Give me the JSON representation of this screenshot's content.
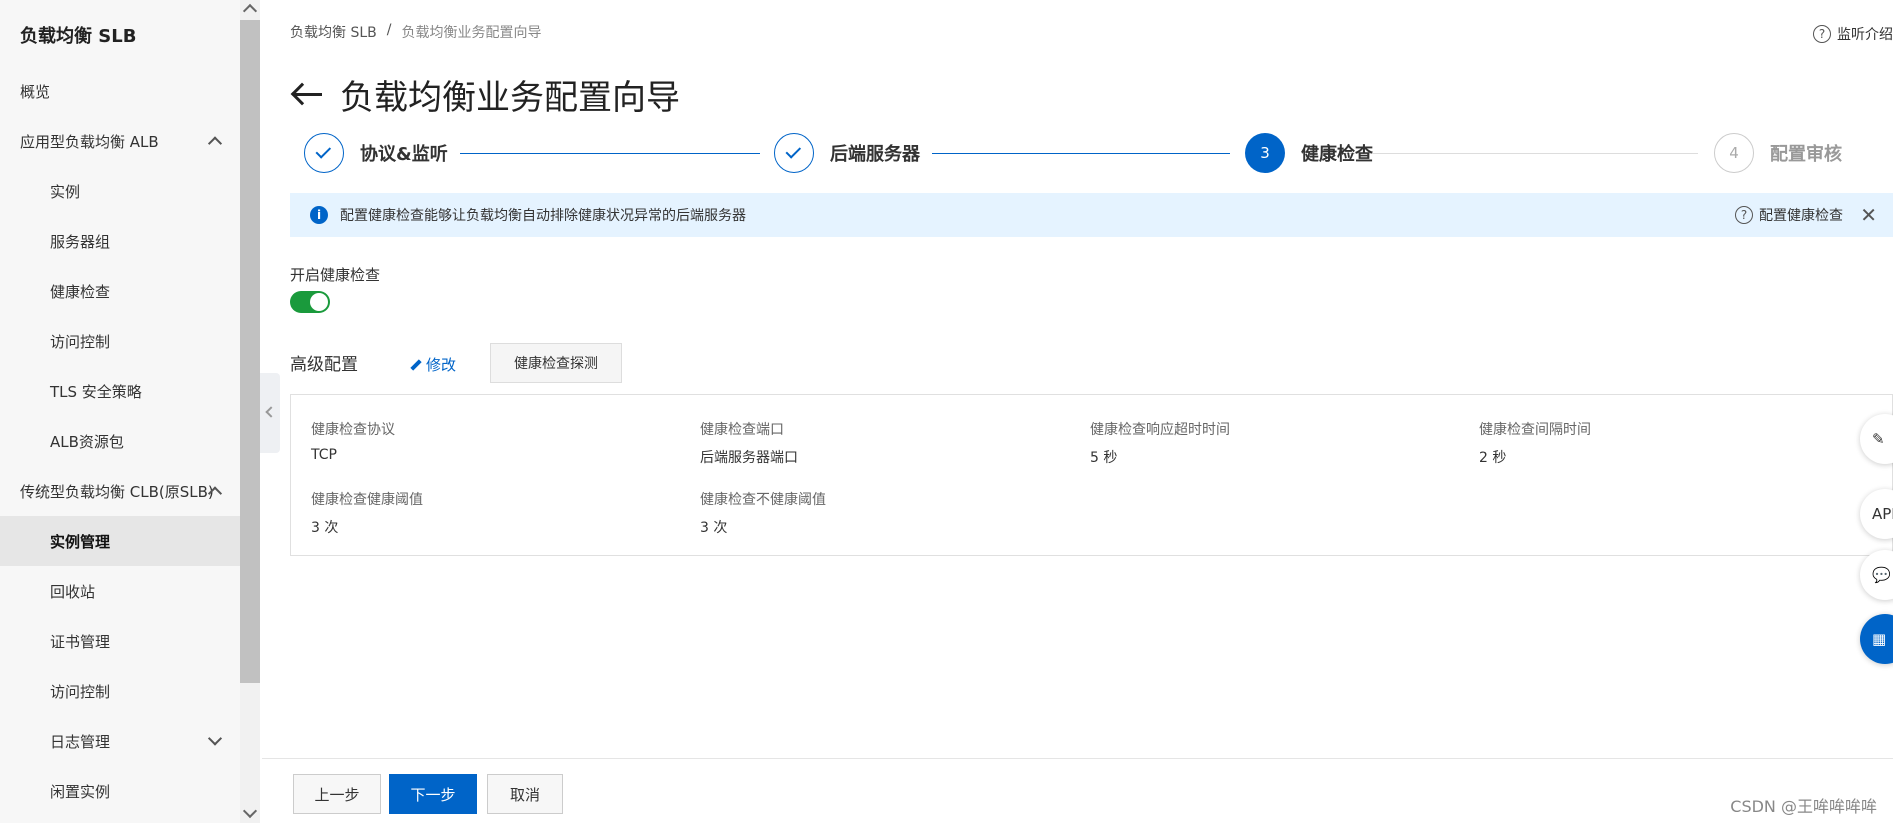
{
  "sidebar": {
    "title": "负载均衡 SLB",
    "items": [
      {
        "label": "概览"
      },
      {
        "label": "应用型负载均衡 ALB"
      },
      {
        "label": "实例"
      },
      {
        "label": "服务器组"
      },
      {
        "label": "健康检查"
      },
      {
        "label": "访问控制"
      },
      {
        "label": "TLS 安全策略"
      },
      {
        "label": "ALB资源包"
      },
      {
        "label": "传统型负载均衡 CLB(原SLB)"
      },
      {
        "label": "实例管理"
      },
      {
        "label": "回收站"
      },
      {
        "label": "证书管理"
      },
      {
        "label": "访问控制"
      },
      {
        "label": "日志管理"
      },
      {
        "label": "闲置实例"
      }
    ]
  },
  "breadcrumb": {
    "root": "负载均衡 SLB",
    "sep": "/",
    "current": "负载均衡业务配置向导"
  },
  "help": {
    "label": "监听介绍",
    "icon": "?"
  },
  "page": {
    "title": "负载均衡业务配置向导"
  },
  "steps": [
    {
      "label": "协议&监听",
      "state": "done"
    },
    {
      "label": "后端服务器",
      "state": "done"
    },
    {
      "label": "健康检查",
      "number": "3",
      "state": "active"
    },
    {
      "label": "配置审核",
      "number": "4",
      "state": "todo"
    }
  ],
  "alert": {
    "icon": "i",
    "text": "配置健康检查能够让负载均衡自动排除健康状况异常的后端服务器",
    "help_label": "配置健康检查",
    "close": "✕"
  },
  "health": {
    "enable_label": "开启健康检查",
    "enabled": true
  },
  "advanced": {
    "title": "高级配置",
    "edit_label": "修改",
    "probe_label": "健康检查探测",
    "fields": [
      {
        "key": "健康检查协议",
        "value": "TCP"
      },
      {
        "key": "健康检查端口",
        "value": "后端服务器端口"
      },
      {
        "key": "健康检查响应超时时间",
        "value": "5 秒"
      },
      {
        "key": "健康检查间隔时间",
        "value": "2 秒"
      },
      {
        "key": "健康检查健康阈值",
        "value": "3 次"
      },
      {
        "key": "健康检查不健康阈值",
        "value": "3 次"
      }
    ]
  },
  "floating": {
    "api_label": "API"
  },
  "footer": {
    "prev": "上一步",
    "next": "下一步",
    "cancel": "取消"
  },
  "watermark": "CSDN @王哞哞哞哞",
  "colors": {
    "primary": "#0064c8",
    "toggle_on": "#1a9a3c",
    "alert_bg": "#e5f3ff"
  }
}
